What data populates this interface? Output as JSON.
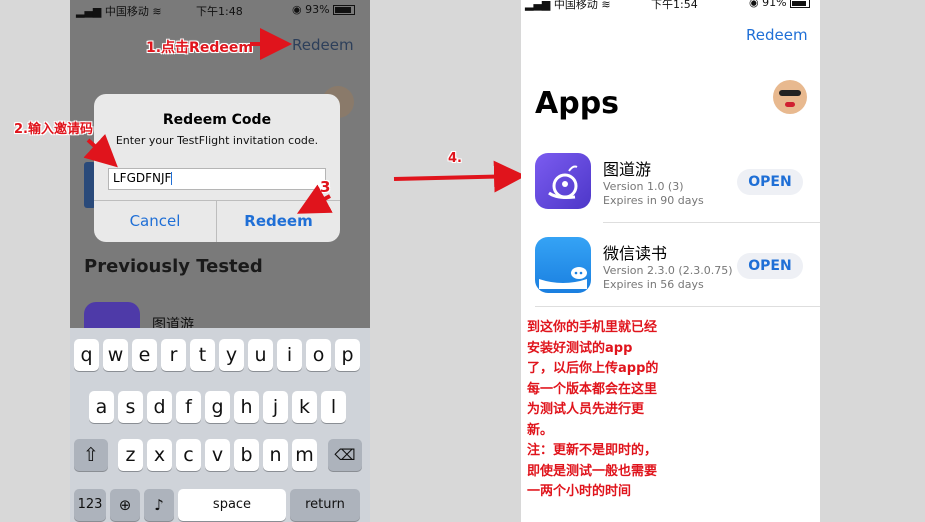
{
  "left_phone": {
    "status": {
      "carrier": "中国移动",
      "time": "下午1:48",
      "battery": "93%"
    },
    "top_redeem": "Redeem",
    "dialog": {
      "title": "Redeem Code",
      "subtitle": "Enter your TestFlight invitation code.",
      "input_value": "LFGDFNJF",
      "cancel": "Cancel",
      "redeem": "Redeem"
    },
    "section_title": "Previously Tested",
    "app_name": "图道游",
    "keyboard": {
      "row1": [
        "q",
        "w",
        "e",
        "r",
        "t",
        "y",
        "u",
        "i",
        "o",
        "p"
      ],
      "row2": [
        "a",
        "s",
        "d",
        "f",
        "g",
        "h",
        "j",
        "k",
        "l"
      ],
      "row3": [
        "z",
        "x",
        "c",
        "v",
        "b",
        "n",
        "m"
      ],
      "num_key": "123",
      "space": "space",
      "return": "return"
    }
  },
  "annotations": {
    "step1": "1.点击Redeem",
    "step2": "2.输入邀请码",
    "step3": "3",
    "step4": "4."
  },
  "right_phone": {
    "status": {
      "carrier": "中国移动",
      "time": "下午1:54",
      "battery": "91%"
    },
    "top_redeem": "Redeem",
    "title": "Apps",
    "apps": [
      {
        "name": "图道游",
        "version": "Version 1.0 (3)",
        "expires": "Expires in 90 days",
        "button": "OPEN"
      },
      {
        "name": "微信读书",
        "version": "Version 2.3.0 (2.3.0.75)",
        "expires": "Expires in 56 days",
        "button": "OPEN"
      }
    ],
    "notes": [
      "到这你的手机里就已经",
      "安装好测试的app",
      "了，以后你上传app的",
      "每一个版本都会在这里",
      "为测试人员先进行更",
      "新。",
      "注：更新不是即时的，",
      "即使是测试一般也需要",
      "一两个小时的时间"
    ]
  },
  "colors": {
    "accent": "#1f6fd6",
    "annotation": "#e0141c"
  }
}
